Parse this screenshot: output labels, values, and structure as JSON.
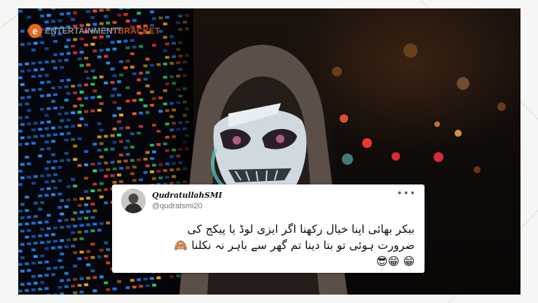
{
  "brand": {
    "logo_letter": "e",
    "logo_name": "ENTERTAINMENT",
    "logo_accent": "BRACKET",
    "accent_color": "#e8671d"
  },
  "tweet": {
    "author_name": "QudratullahSMI",
    "handle": "@qudratsmi20",
    "text": "ببکر بھائی اپنا خیال رکھنا اگر ایزی لوڈ یا پیکج کی ضرورت ہوئی تو بتا دینا تم گھر سے باہر نہ نکلنا 🙈😁 😁😎",
    "more_glyph": "•••"
  },
  "icons": {
    "more": "more-options-icon",
    "avatar": "profile-avatar"
  }
}
